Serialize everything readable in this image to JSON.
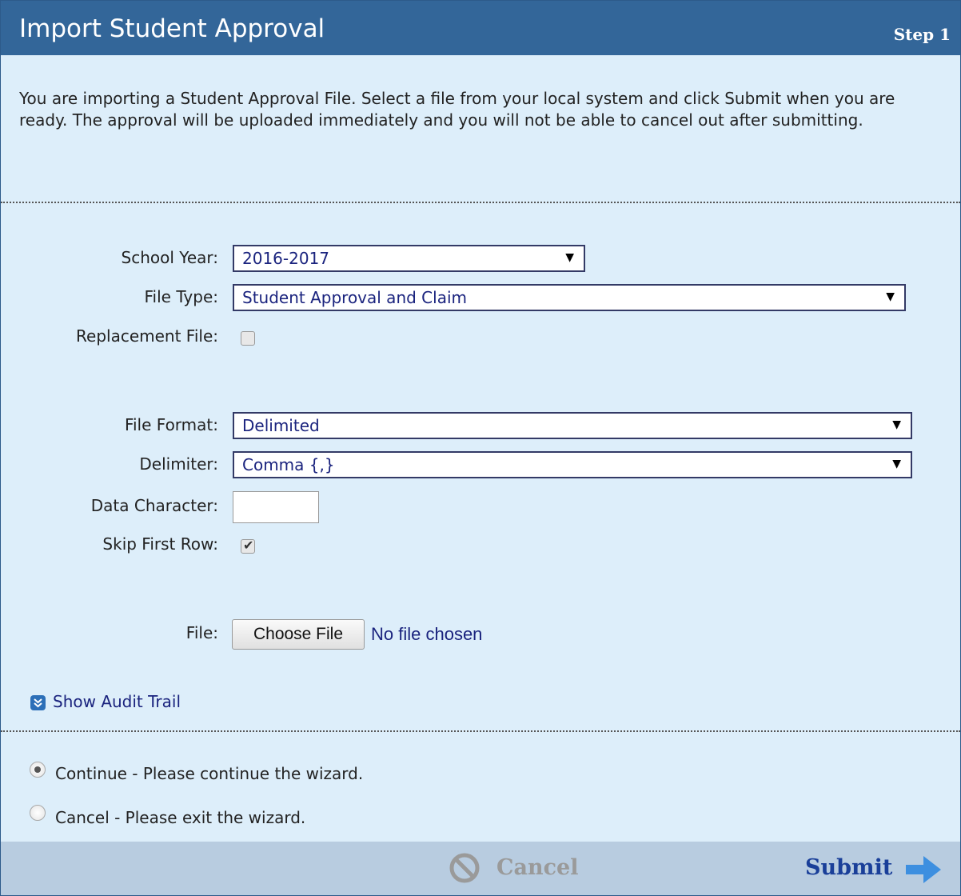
{
  "header": {
    "title": "Import Student Approval",
    "step": "Step 1"
  },
  "intro": "You are importing a Student Approval File. Select a file from your local system and click Submit when you are ready. The approval will be uploaded immediately and you will not be able to cancel out after submitting.",
  "form": {
    "school_year": {
      "label": "School Year:",
      "value": "2016-2017"
    },
    "file_type": {
      "label": "File Type:",
      "value": "Student Approval and Claim"
    },
    "replacement_file": {
      "label": "Replacement File:",
      "checked": false
    },
    "file_format": {
      "label": "File Format:",
      "value": "Delimited"
    },
    "delimiter": {
      "label": "Delimiter:",
      "value": "Comma {,}"
    },
    "data_character": {
      "label": "Data Character:",
      "value": ""
    },
    "skip_first_row": {
      "label": "Skip First Row:",
      "checked": true
    },
    "file": {
      "label": "File:",
      "button": "Choose File",
      "status": "No file chosen"
    }
  },
  "audit_trail": {
    "label": "Show Audit Trail"
  },
  "options": {
    "continue_label": "Continue - Please continue the wizard.",
    "cancel_label": "Cancel - Please exit the wizard.",
    "selected": "continue"
  },
  "footer": {
    "cancel_label": "Cancel",
    "submit_label": "Submit"
  },
  "icons": {
    "dropdown": "chevron-down-icon",
    "checkmark": "checkmark-icon",
    "audit": "double-chevron-down-icon",
    "cancel": "prohibited-icon",
    "submit": "arrow-right-icon"
  },
  "colors": {
    "header_bg": "#336699",
    "panel_bg": "#ddeefa",
    "footer_bg": "#b8cce0",
    "link": "#1a237e",
    "submit": "#1a3f99",
    "disabled": "#9a9a9a",
    "arrow": "#3d8fe0"
  }
}
